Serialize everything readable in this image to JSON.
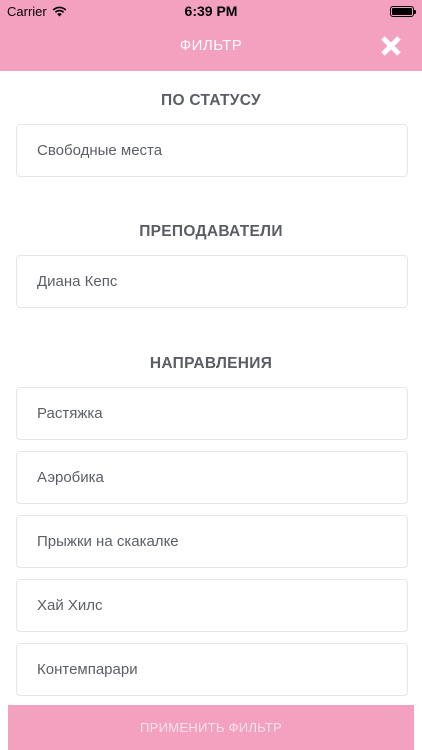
{
  "status_bar": {
    "carrier": "Carrier",
    "time": "6:39 PM",
    "battery_level": 1.0
  },
  "header": {
    "title": "ФИЛЬТР",
    "close_icon": "close-x-icon"
  },
  "sections": [
    {
      "title": "ПО СТАТУСУ",
      "options": [
        "Свободные места"
      ]
    },
    {
      "title": "ПРЕПОДАВАТЕЛИ",
      "options": [
        "Диана Кепс"
      ]
    },
    {
      "title": "НАПРАВЛЕНИЯ",
      "options": [
        "Растяжка",
        "Аэробика",
        "Прыжки на скакалке",
        "Хай Хилс",
        "Контемпарари"
      ]
    }
  ],
  "apply_button": {
    "label": "ПРИМЕНИТЬ ФИЛЬТР"
  },
  "colors": {
    "accent": "#f4a0bf",
    "text": "#5b5f66",
    "border": "#e6e6e9",
    "button_text": "#fbe3ec"
  }
}
